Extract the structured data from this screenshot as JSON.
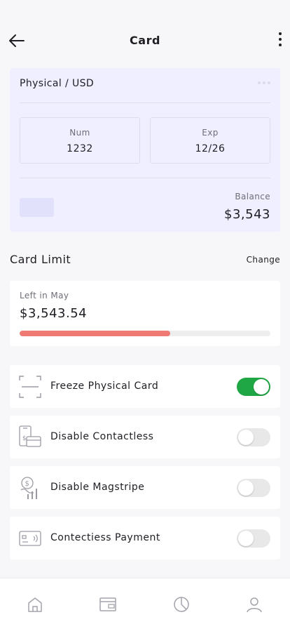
{
  "header": {
    "title": "Card",
    "back_icon": "arrow-left-icon",
    "menu_icon": "more-vertical-icon"
  },
  "card": {
    "type_label": "Physical / USD",
    "num_label": "Num",
    "num_value": "1232",
    "exp_label": "Exp",
    "exp_value": "12/26",
    "balance_label": "Balance",
    "balance_value": "$3,543",
    "background_color": "#f0efff"
  },
  "limit": {
    "section_title": "Card Limit",
    "change_label": "Change",
    "period_label": "Left in May",
    "amount": "$3,543.54",
    "progress_fraction": 0.6,
    "progress_color": "#ee7a73"
  },
  "settings": [
    {
      "label": "Freeze Physical Card",
      "icon": "freeze-scan-icon",
      "enabled": true
    },
    {
      "label": "Disable Contactless",
      "icon": "contactless-phone-card-icon",
      "enabled": false
    },
    {
      "label": "Disable Magstripe",
      "icon": "magstripe-hand-icon",
      "enabled": false
    },
    {
      "label": "Contectiess Payment",
      "icon": "card-payment-icon",
      "enabled": false
    }
  ],
  "toggle_on_color": "#20a745",
  "tabbar": {
    "items": [
      "home-icon",
      "wallet-icon",
      "pie-chart-icon",
      "profile-icon"
    ]
  }
}
